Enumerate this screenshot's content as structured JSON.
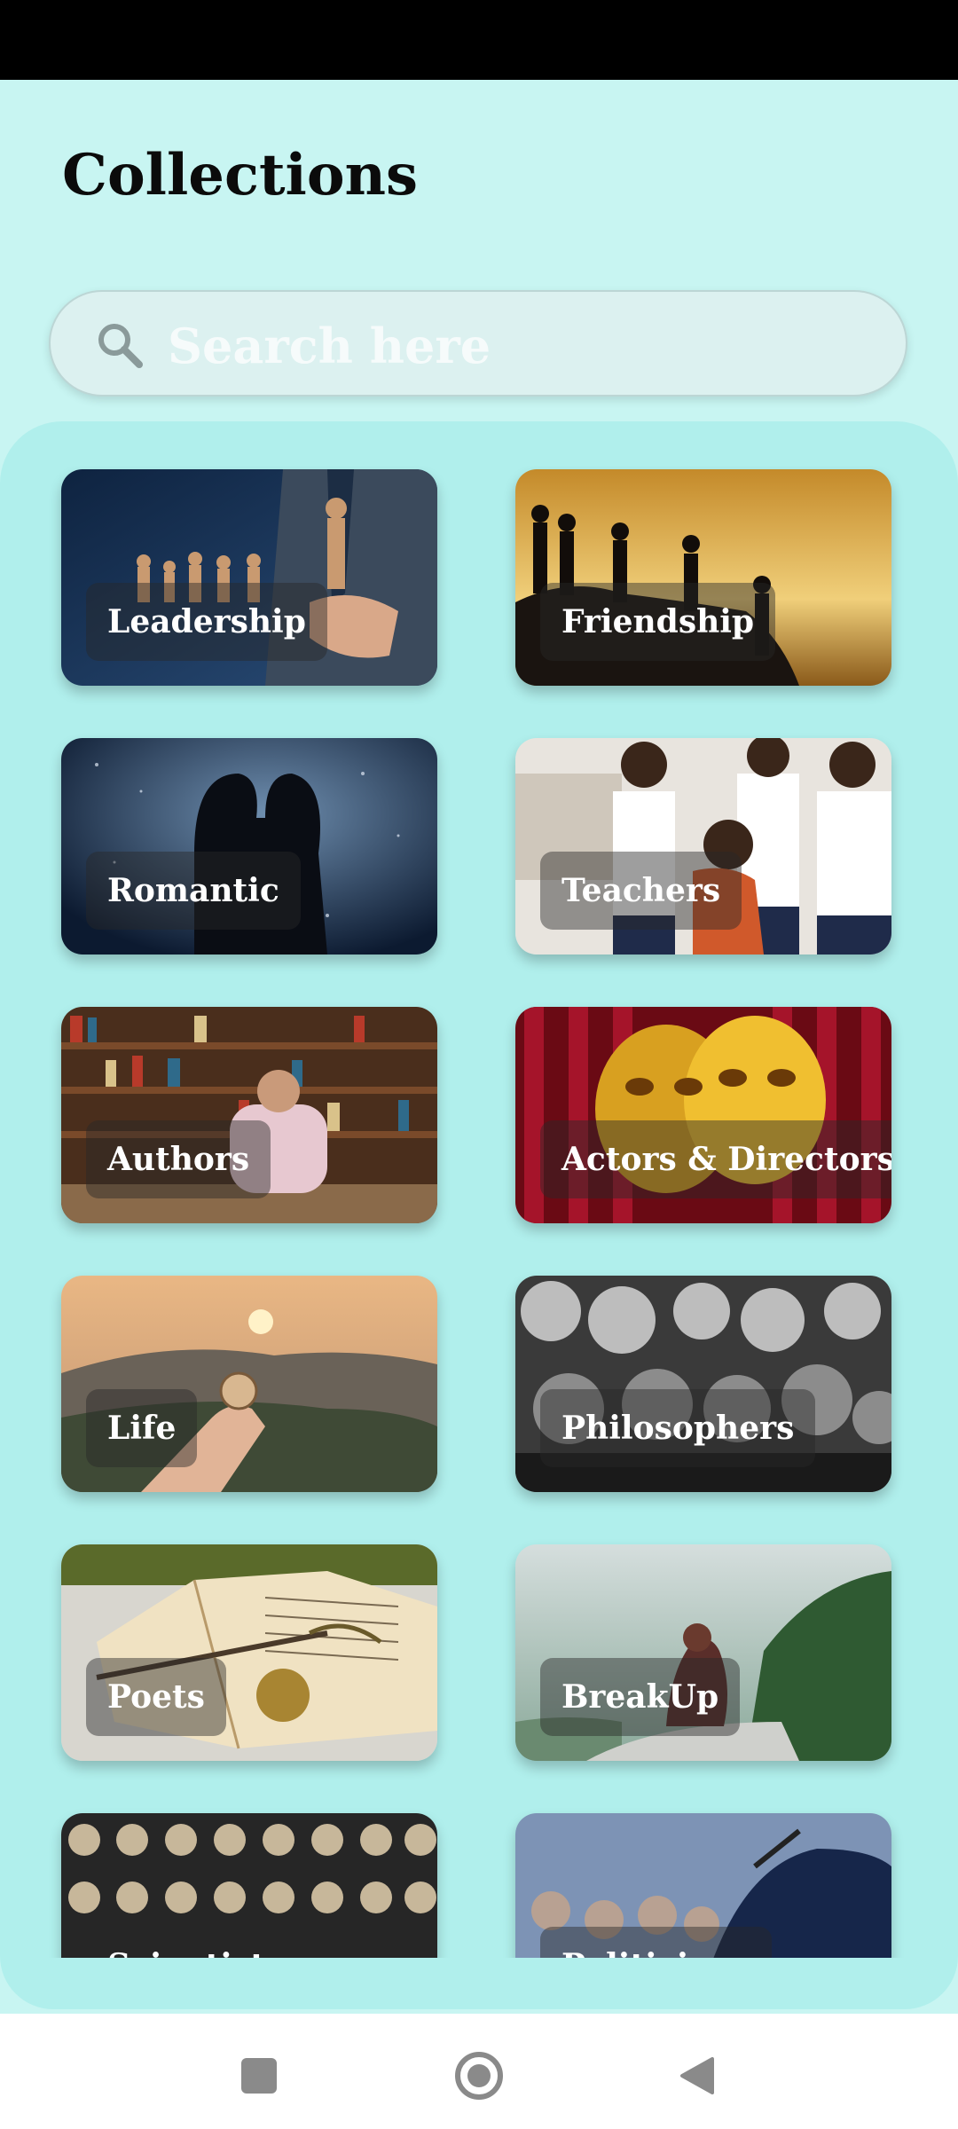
{
  "header": {
    "title": "Collections"
  },
  "search": {
    "placeholder": "Search here",
    "value": ""
  },
  "icons": {
    "search": "search-icon",
    "nav_recents": "square-icon",
    "nav_home": "circle-icon",
    "nav_back": "triangle-back-icon"
  },
  "collections": [
    {
      "label": "Leadership",
      "theme": "#1d3a5c"
    },
    {
      "label": "Friendship",
      "theme": "#d8a24a"
    },
    {
      "label": "Romantic",
      "theme": "#1a2f4a"
    },
    {
      "label": "Teachers",
      "theme": "#ece7e1"
    },
    {
      "label": "Authors",
      "theme": "#6a4a2e"
    },
    {
      "label": "Actors & Directors",
      "theme": "#8f0f1f"
    },
    {
      "label": "Life",
      "theme": "#b98a5a"
    },
    {
      "label": "Philosophers",
      "theme": "#6e6e6e"
    },
    {
      "label": "Poets",
      "theme": "#d9c7a6"
    },
    {
      "label": "BreakUp",
      "theme": "#a9bfb6"
    },
    {
      "label": "Scientists",
      "theme": "#3a3a3a"
    },
    {
      "label": "Politicians",
      "theme": "#27406b"
    }
  ],
  "colors": {
    "background": "#c8f5f2",
    "panel": "#b0efec",
    "search_fill": "#dcf1f0",
    "title_text": "#0b0b0b"
  }
}
